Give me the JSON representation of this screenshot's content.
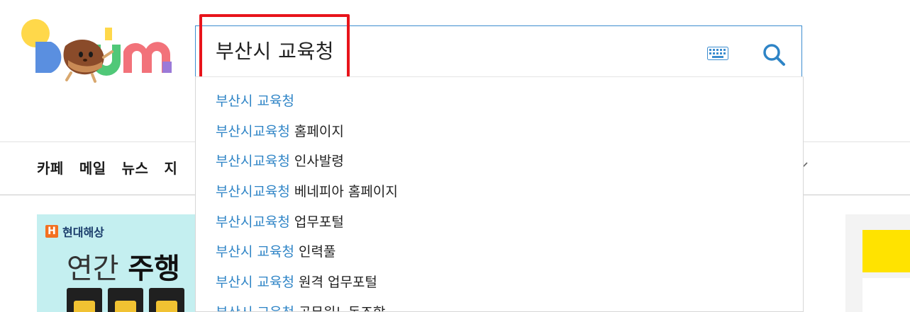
{
  "header": {
    "logo_alt": "Daum",
    "search": {
      "value": "부산시 교육청",
      "placeholder": ""
    }
  },
  "suggestions": [
    {
      "match": "부산시 교육청",
      "rest": ""
    },
    {
      "match": "부산시교육청",
      "rest": " 홈페이지"
    },
    {
      "match": "부산시교육청",
      "rest": " 인사발령"
    },
    {
      "match": "부산시교육청",
      "rest": " 베네피아 홈페이지"
    },
    {
      "match": "부산시교육청",
      "rest": " 업무포털"
    },
    {
      "match": "부산시 교육청",
      "rest": " 인력풀"
    },
    {
      "match": "부산시 교육청",
      "rest": " 원격 업무포털"
    },
    {
      "match": "부산시 교육청",
      "rest": " 공무원노동조합"
    }
  ],
  "nav": {
    "items": [
      "카페",
      "메일",
      "뉴스",
      "지"
    ]
  },
  "ad": {
    "brand_mark": "H",
    "brand": "현대해상",
    "headline_light": "연간 ",
    "headline_bold": "주행"
  },
  "colors": {
    "search_border": "#3c8dcf",
    "highlight_border": "#e8141b",
    "suggest_match": "#2e84c6",
    "ad_bg": "#c4eff0",
    "banner_yellow": "#ffe300"
  }
}
